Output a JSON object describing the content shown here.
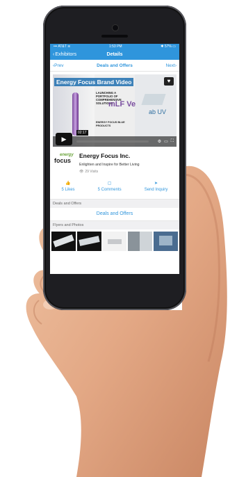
{
  "status_bar": {
    "carrier": "••• AT&T ≋",
    "time": "1:53 PM",
    "battery": "✱ 57% ▭"
  },
  "nav": {
    "back_label": "Exhibitors",
    "title": "Details"
  },
  "subnav": {
    "prev_label": "Prev",
    "title": "Deals and Offers",
    "next_label": "Next"
  },
  "video": {
    "title": "Energy Focus Brand Video",
    "caption": "LAUNCHING A PORTFOLIO OF COMPREHENSIVE SOLUTIONS",
    "caption2": "ENERGY FOCUS BLUE PRODUCTS",
    "duration": "02:17",
    "mufve": "mLF Ve",
    "abuv": "ab UV"
  },
  "exhibitor": {
    "logo_top": "energy",
    "logo_bottom": "focus",
    "name": "Energy Focus Inc.",
    "tagline": "Enlighten and Inspire for Better Living",
    "visits": "29 Visits"
  },
  "actions": [
    {
      "label": "5 Likes",
      "icon": "thumbs-up-icon"
    },
    {
      "label": "5 Comments",
      "icon": "comment-icon"
    },
    {
      "label": "Send Inquiry",
      "icon": "send-icon"
    }
  ],
  "sections": {
    "deals_header": "Deals and Offers",
    "deals_link": "Deals and Offers",
    "flyers_header": "Flyers and Photos"
  },
  "colors": {
    "accent": "#2f95dc",
    "phone_body": "#1e1e22"
  }
}
